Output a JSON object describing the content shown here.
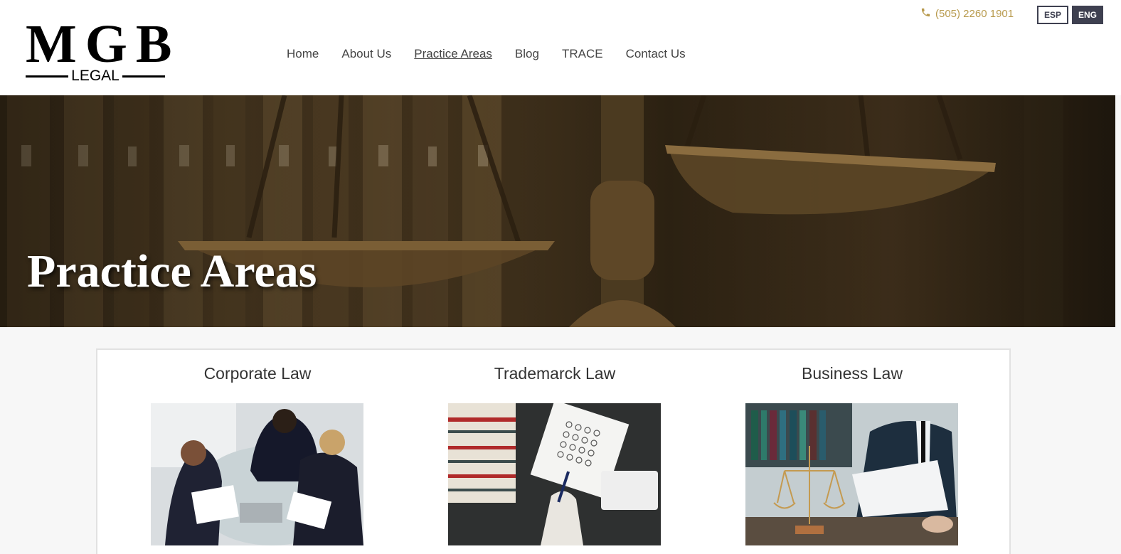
{
  "header": {
    "logo": {
      "mark": "MGB",
      "sub": "LEGAL"
    },
    "nav": [
      {
        "label": "Home"
      },
      {
        "label": "About Us"
      },
      {
        "label": "Practice Areas"
      },
      {
        "label": "Blog"
      },
      {
        "label": "TRACE"
      },
      {
        "label": "Contact Us"
      }
    ],
    "active_nav": "Practice Areas",
    "phone": "(505) 2260 1901",
    "lang": {
      "esp": "ESP",
      "eng": "ENG",
      "active": "ENG"
    }
  },
  "hero": {
    "title": "Practice Areas"
  },
  "practice_areas": [
    {
      "title": "Corporate Law",
      "icon": "business-meeting-image"
    },
    {
      "title": "Trademarck Law",
      "icon": "trademark-sheet-image"
    },
    {
      "title": "Business Law",
      "icon": "scales-of-justice-image"
    }
  ],
  "colors": {
    "accent": "#b89a4d",
    "lang_dark": "#3e4050",
    "hero_tone": "#3a2c19"
  }
}
